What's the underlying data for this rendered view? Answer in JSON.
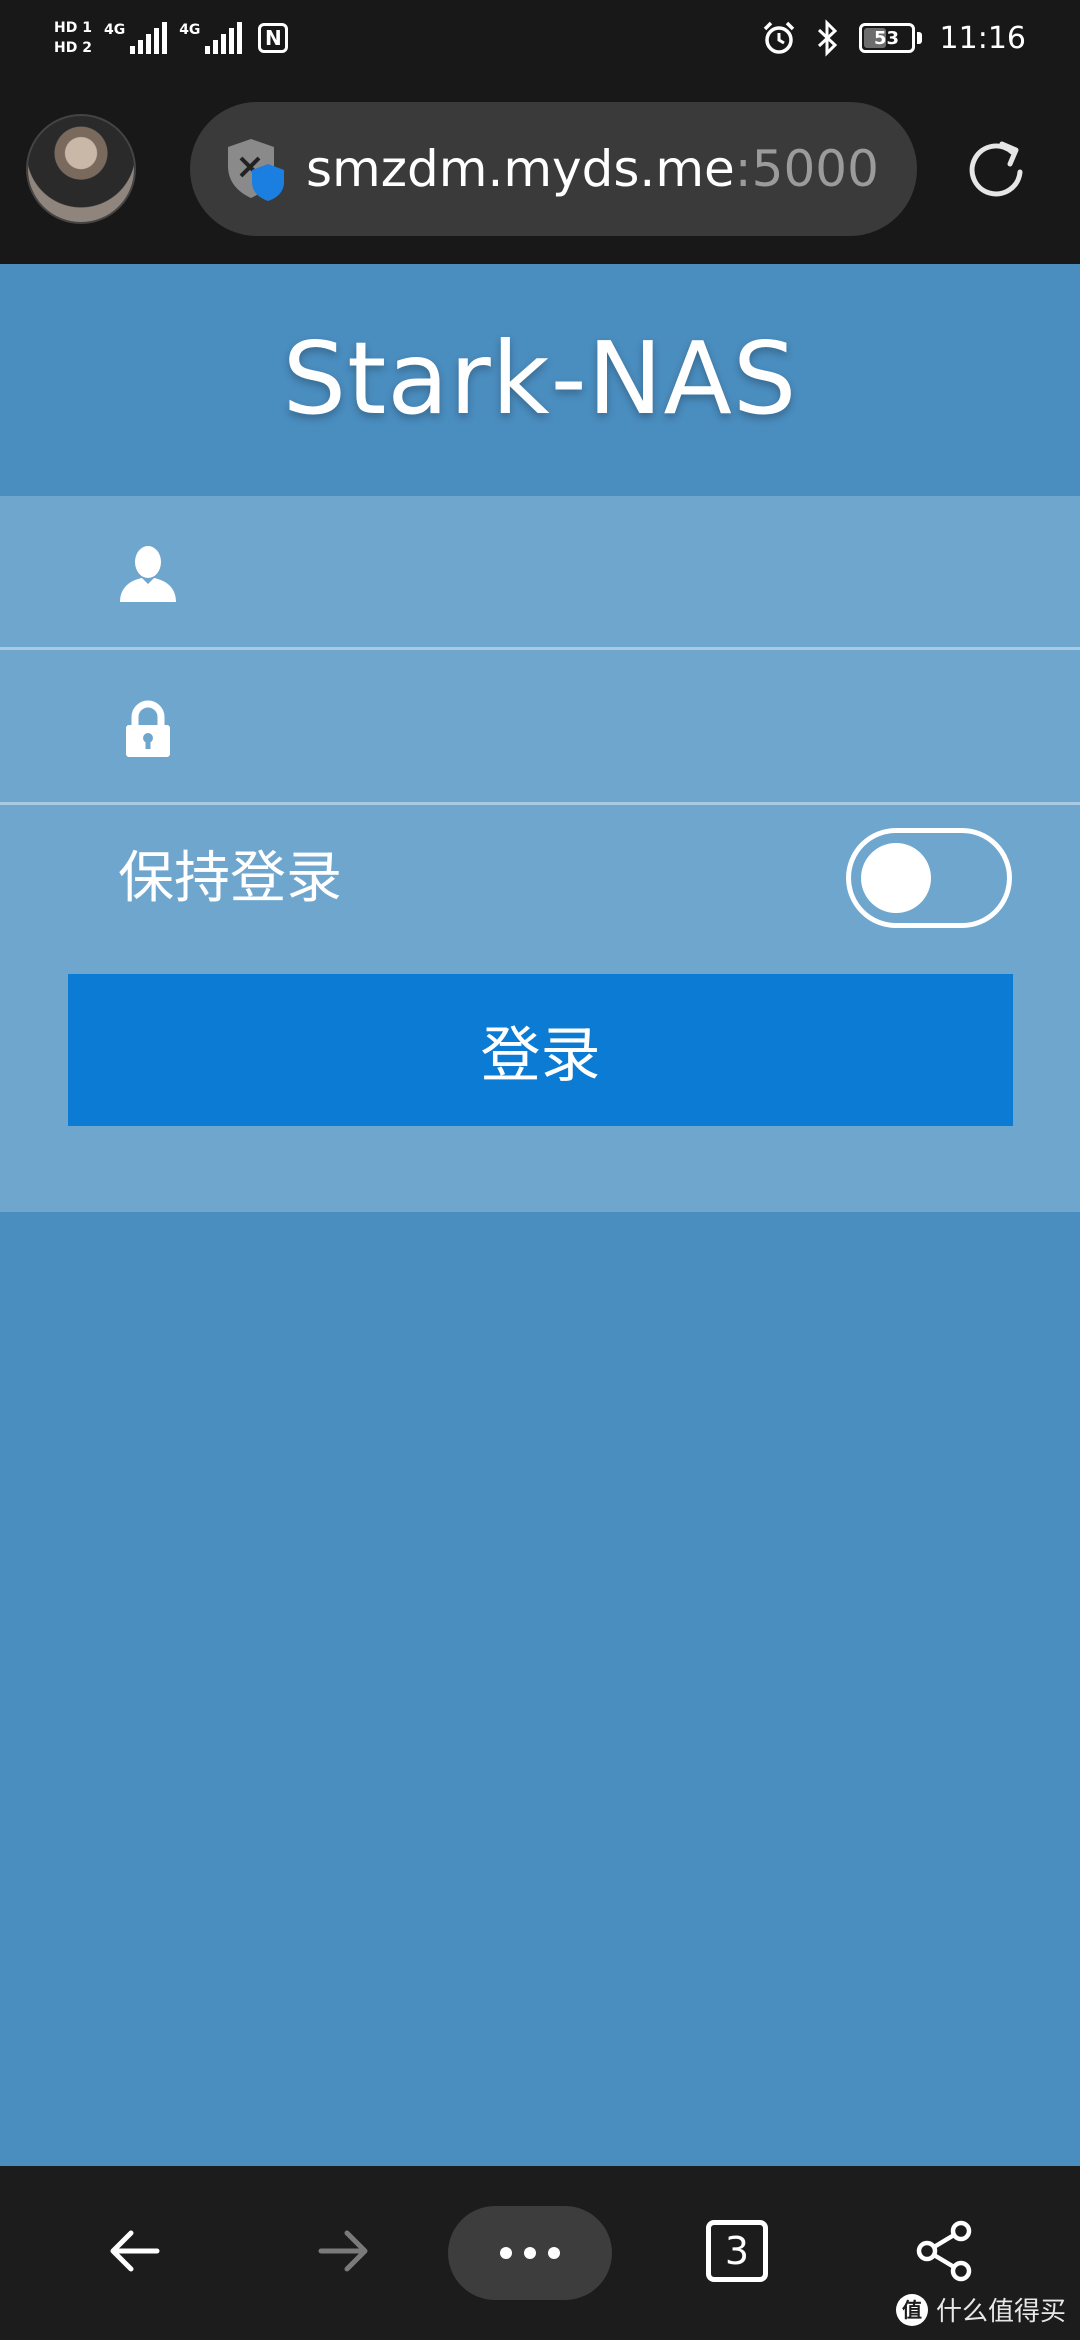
{
  "status_bar": {
    "sim1_label": "HD 1",
    "sim2_label": "HD 2",
    "network1": "4G",
    "network2": "4G",
    "nfc_label": "N",
    "battery_level": "53",
    "time": "11:16",
    "icons": [
      "alarm-icon",
      "bluetooth-icon",
      "battery-icon",
      "nfc-icon",
      "signal-icon"
    ]
  },
  "browser": {
    "url_host": "smzdm.myds.me",
    "url_port": ":5000",
    "icons": [
      "avatar",
      "security-shield-icon",
      "reload-icon"
    ]
  },
  "page": {
    "title": "Stark-NAS",
    "username_placeholder": "",
    "password_placeholder": "",
    "remember_label": "保持登录",
    "remember_on": false,
    "login_button": "登录",
    "colors": {
      "background": "#4a8dbf",
      "form_band": "#6fa6cd",
      "button": "#0b7bd3"
    }
  },
  "bottom_nav": {
    "tab_count": "3",
    "watermark": "什么值得买",
    "icons": [
      "back-arrow-icon",
      "forward-arrow-icon",
      "more-icon",
      "tabs-icon",
      "share-icon"
    ]
  }
}
